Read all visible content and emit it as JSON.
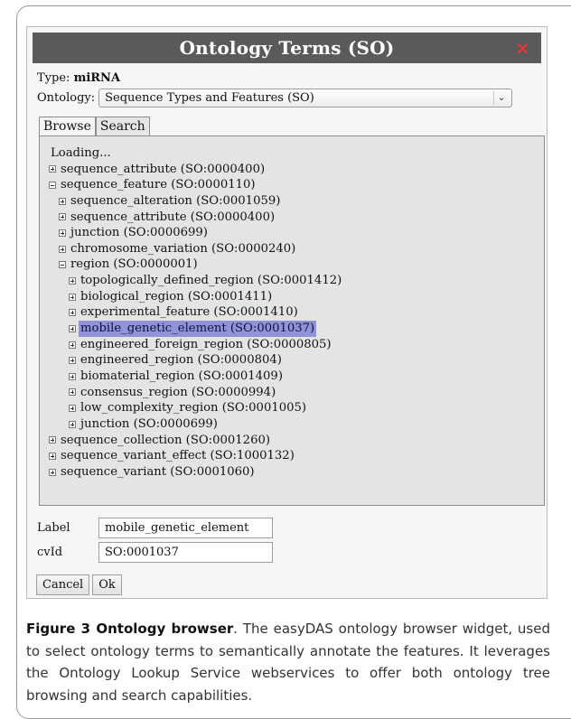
{
  "dialog": {
    "title": "Ontology Terms (SO)",
    "close_icon": "✕",
    "type_label": "Type:",
    "type_value": "miRNA",
    "ontology_label": "Ontology:",
    "ontology_selected": "Sequence Types and Features (SO)",
    "tabs": [
      {
        "label": "Browse",
        "active": true
      },
      {
        "label": "Search",
        "active": false
      }
    ],
    "tree": [
      {
        "label": "Loading...",
        "depth": 0,
        "expander": "none"
      },
      {
        "label": "sequence_attribute (SO:0000400)",
        "depth": 0,
        "expander": "plus"
      },
      {
        "label": "sequence_feature (SO:0000110)",
        "depth": 0,
        "expander": "minus"
      },
      {
        "label": "sequence_alteration (SO:0001059)",
        "depth": 1,
        "expander": "plus"
      },
      {
        "label": "sequence_attribute (SO:0000400)",
        "depth": 1,
        "expander": "plus"
      },
      {
        "label": "junction (SO:0000699)",
        "depth": 1,
        "expander": "plus"
      },
      {
        "label": "chromosome_variation (SO:0000240)",
        "depth": 1,
        "expander": "plus"
      },
      {
        "label": "region (SO:0000001)",
        "depth": 1,
        "expander": "minus"
      },
      {
        "label": "topologically_defined_region (SO:0001412)",
        "depth": 2,
        "expander": "plus"
      },
      {
        "label": "biological_region (SO:0001411)",
        "depth": 2,
        "expander": "plus"
      },
      {
        "label": "experimental_feature (SO:0001410)",
        "depth": 2,
        "expander": "plus"
      },
      {
        "label": "mobile_genetic_element (SO:0001037)",
        "depth": 2,
        "expander": "plus",
        "selected": true
      },
      {
        "label": "engineered_foreign_region (SO:0000805)",
        "depth": 2,
        "expander": "plus"
      },
      {
        "label": "engineered_region (SO:0000804)",
        "depth": 2,
        "expander": "plus"
      },
      {
        "label": "biomaterial_region (SO:0001409)",
        "depth": 2,
        "expander": "plus"
      },
      {
        "label": "consensus_region (SO:0000994)",
        "depth": 2,
        "expander": "plus"
      },
      {
        "label": "low_complexity_region (SO:0001005)",
        "depth": 2,
        "expander": "plus"
      },
      {
        "label": "junction (SO:0000699)",
        "depth": 2,
        "expander": "plus"
      },
      {
        "label": "sequence_collection (SO:0001260)",
        "depth": 0,
        "expander": "plus"
      },
      {
        "label": "sequence_variant_effect (SO:1000132)",
        "depth": 0,
        "expander": "plus"
      },
      {
        "label": "sequence_variant (SO:0001060)",
        "depth": 0,
        "expander": "plus"
      }
    ],
    "label_field": {
      "label": "Label",
      "value": "mobile_genetic_element"
    },
    "cvid_field": {
      "label": "cvId",
      "value": "SO:0001037"
    },
    "cancel_label": "Cancel",
    "ok_label": "Ok"
  },
  "caption": {
    "figure_label": "Figure 3 Ontology browser",
    "text": ". The easyDAS ontology browser widget, used to select ontology terms to semantically annotate the features. It leverages the Ontology Lookup Service webservices to offer both ontology tree browsing and search capabilities."
  },
  "colors": {
    "titlebar": "#5a5a5a",
    "close": "#ff3030",
    "selection": "#8f93d8",
    "tree_bg": "#e4e4e4"
  }
}
